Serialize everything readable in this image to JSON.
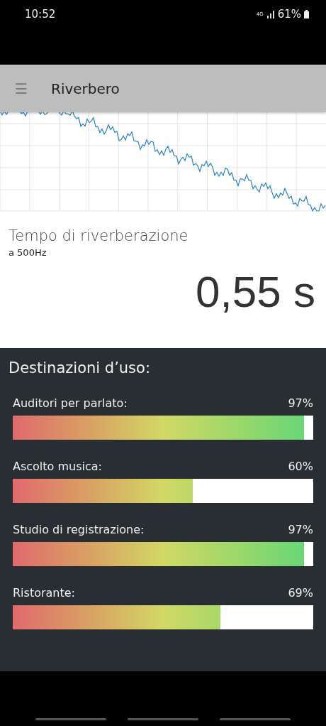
{
  "status_bar": {
    "time": "10:52",
    "network": "4G",
    "battery": "61%"
  },
  "app_bar": {
    "menu_icon": "☰",
    "title": "Riverbero"
  },
  "reverb": {
    "title": "Tempo di riverberazione",
    "subtitle": "a 500Hz",
    "value": "0,55 s"
  },
  "uses": {
    "title": "Destinazioni d’uso:",
    "items": [
      {
        "name": "Auditori per parlato:",
        "reading": "97%",
        "level": 0.97
      },
      {
        "name": "Ascolto musica:",
        "reading": "60%",
        "level": 0.6
      },
      {
        "name": "Studio di registrazione:",
        "reading": "97%",
        "level": 0.97
      },
      {
        "name": "Ristorante:",
        "reading": "69%",
        "level": 0.69
      }
    ]
  }
}
